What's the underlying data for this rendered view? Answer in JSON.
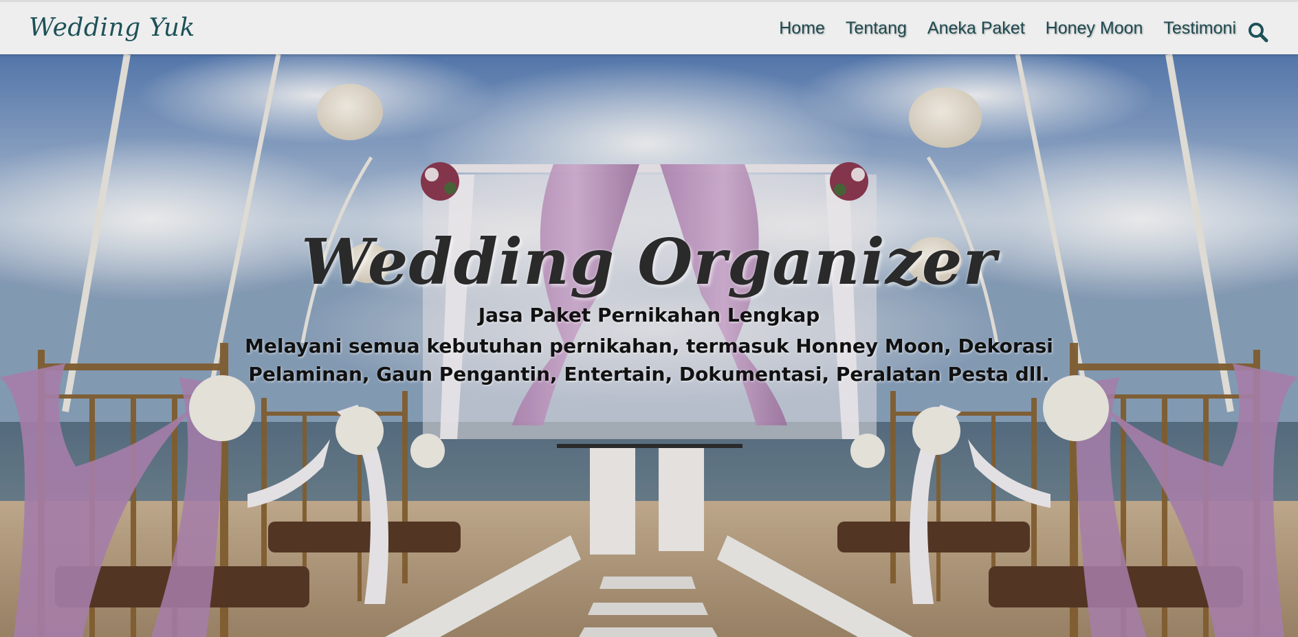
{
  "navbar": {
    "brand": "Wedding Yuk",
    "links": [
      "Home",
      "Tentang",
      "Aneka Paket",
      "Honey Moon",
      "Testimoni"
    ],
    "search_icon": "search-icon"
  },
  "hero": {
    "title": "Wedding Organizer",
    "subtitle": "Jasa Paket Pernikahan Lengkap",
    "description": "Melayani semua kebutuhan pernikahan, termasuk Honney Moon, Dekorasi Pelaminan, Gaun Pengantin, Entertain, Dokumentasi, Peralatan Pesta dll."
  },
  "colors": {
    "navbar_bg": "#eeeeee",
    "brand": "#1d5158",
    "nav_link": "#1d4a50",
    "sky": "#6f93c4",
    "drape": "#c79ac9",
    "sand": "#d9c3a6"
  }
}
